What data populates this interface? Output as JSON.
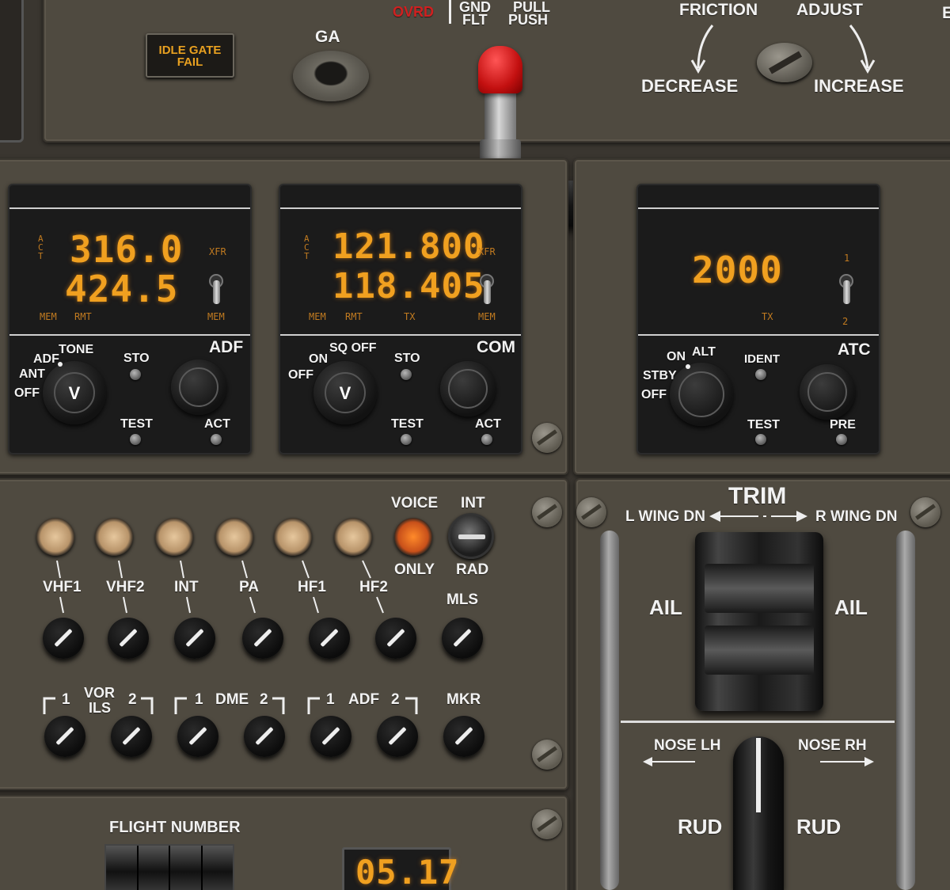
{
  "top": {
    "idle_gate": "IDLE GATE\nFAIL",
    "ga": "GA",
    "ovrd": "OVRD",
    "gnd": "GND",
    "flt": "FLT",
    "pull": "PULL",
    "push": "PUSH",
    "friction": "FRICTION",
    "adjust": "ADJUST",
    "decrease": "DECREASE",
    "increase": "INCREASE",
    "edge": "E"
  },
  "adf": {
    "act_tag": "A\nC\nT",
    "active": "316.0",
    "standby": "424.5",
    "xfr": "XFR",
    "mem_l": "MEM",
    "rmt": "RMT",
    "mem_r": "MEM",
    "title": "ADF",
    "tone": "TONE",
    "adf_pos": "ADF",
    "ant": "ANT",
    "off": "OFF",
    "knob": "V",
    "sto": "STO",
    "test": "TEST",
    "act": "ACT"
  },
  "com": {
    "act_tag": "A\nC\nT",
    "active": "121.800",
    "standby": "118.405",
    "xfr": "XFR",
    "mem_l": "MEM",
    "rmt": "RMT",
    "tx": "TX",
    "mem_r": "MEM",
    "title": "COM",
    "on": "ON",
    "sq_off": "SQ OFF",
    "off": "OFF",
    "knob": "V",
    "sto": "STO",
    "test": "TEST",
    "act": "ACT"
  },
  "atc": {
    "code": "2000",
    "tx": "TX",
    "pos1": "1",
    "pos2": "2",
    "title": "ATC",
    "on": "ON",
    "alt": "ALT",
    "stby": "STBY",
    "off": "OFF",
    "ident": "IDENT",
    "test": "TEST",
    "pre": "PRE"
  },
  "audio": {
    "voice": "VOICE",
    "only": "ONLY",
    "int": "INT",
    "rad": "RAD",
    "mls": "MLS",
    "mkr": "MKR",
    "mic_labels": [
      "VHF1",
      "VHF2",
      "INT",
      "PA",
      "HF1",
      "HF2"
    ],
    "nav_1a": "1",
    "vor": "VOR",
    "ils": "ILS",
    "nav_2a": "2",
    "nav_1b": "1",
    "dme": "DME",
    "nav_2b": "2",
    "nav_1c": "1",
    "adf": "ADF",
    "nav_2c": "2"
  },
  "trim": {
    "title": "TRIM",
    "l_wing": "L WING DN",
    "r_wing": "R WING DN",
    "ail_l": "AIL",
    "ail_r": "AIL",
    "nose_lh": "NOSE LH",
    "nose_rh": "NOSE RH",
    "rud_l": "RUD",
    "rud_r": "RUD"
  },
  "flight": {
    "label": "FLIGHT NUMBER",
    "clock": "05.17"
  },
  "colors": {
    "lcd": "#f0a020",
    "ovrd": "#d02020",
    "panel": "#4f4a40"
  }
}
